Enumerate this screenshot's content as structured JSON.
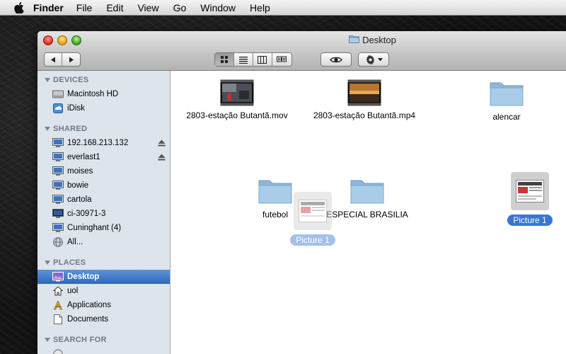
{
  "menubar": {
    "app_name": "Finder",
    "items": [
      "File",
      "Edit",
      "View",
      "Go",
      "Window",
      "Help"
    ]
  },
  "window": {
    "title": "Desktop"
  },
  "sidebar": {
    "devices_header": "DEVICES",
    "devices": [
      "Macintosh HD",
      "iDisk"
    ],
    "shared_header": "SHARED",
    "shared": [
      "192.168.213.132",
      "everlast1",
      "moises",
      "bowie",
      "cartola",
      "ci-30971-3",
      "Cuninghant (4)",
      "All..."
    ],
    "places_header": "PLACES",
    "places": [
      "Desktop",
      "uol",
      "Applications",
      "Documents"
    ],
    "search_header": "SEARCH FOR"
  },
  "files": {
    "f1": "2803-estação Butantã.mov",
    "f2": "2803-estação Butantã.mp4",
    "f3": "alencar",
    "f4": "futebol",
    "f5": "ESPECIAL BRASILIA",
    "f6": "Picture 1",
    "drag_ghost": "Picture 1"
  },
  "colors": {
    "selection": "#3875d7",
    "sidebar_bg": "#dde4ec"
  }
}
